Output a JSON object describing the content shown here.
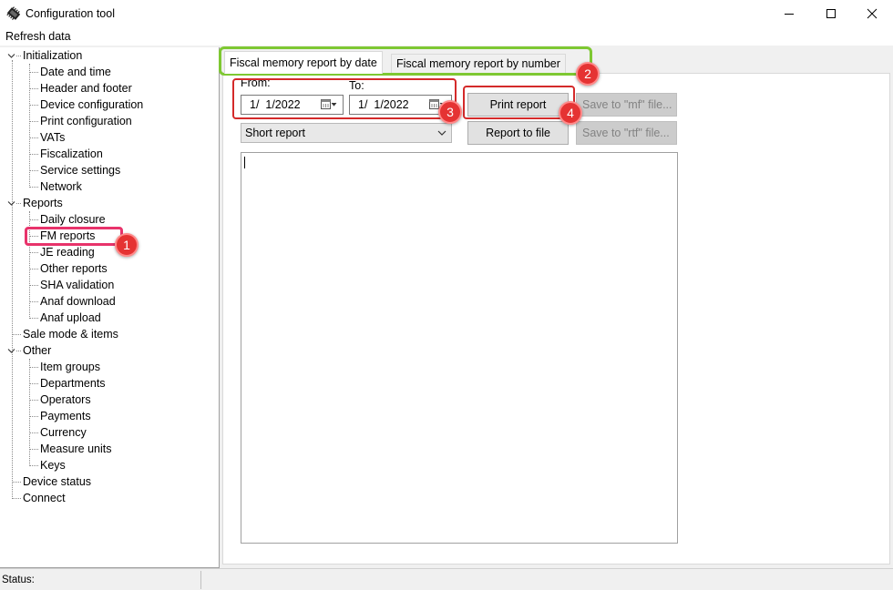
{
  "window": {
    "title": "Configuration tool",
    "controls": [
      "minimize",
      "maximize",
      "close"
    ]
  },
  "menu": {
    "refresh": "Refresh data"
  },
  "tree": {
    "initialization": {
      "label": "Initialization",
      "children": [
        "Date and time",
        "Header and footer",
        "Device configuration",
        "Print configuration",
        "VATs",
        "Fiscalization",
        "Service settings",
        "Network"
      ]
    },
    "reports": {
      "label": "Reports",
      "children": [
        "Daily closure",
        "FM reports",
        "JE reading",
        "Other reports",
        "SHA validation",
        "Anaf download",
        "Anaf upload"
      ]
    },
    "sale_mode": {
      "label": "Sale mode & items"
    },
    "other": {
      "label": "Other",
      "children": [
        "Item groups",
        "Departments",
        "Operators",
        "Payments",
        "Currency",
        "Measure units",
        "Keys"
      ]
    },
    "device_status": {
      "label": "Device status"
    },
    "connect": {
      "label": "Connect"
    }
  },
  "tabs": [
    {
      "label": "Fiscal memory report by date",
      "active": true
    },
    {
      "label": "Fiscal memory report by number",
      "active": false
    }
  ],
  "form": {
    "from_label": "From:",
    "to_label": "To:",
    "from_value": "1/  1/2022",
    "to_value": "1/  1/2022",
    "report_type": "Short report"
  },
  "buttons": {
    "print_report": "Print report",
    "report_to_file": "Report to file",
    "save_mf": "Save to \"mf\" file...",
    "save_rtf": "Save to \"rtf\" file..."
  },
  "annotations": [
    "1",
    "2",
    "3",
    "4"
  ],
  "colors": {
    "annotation_red": "#e53333",
    "highlight_pink": "#e8336b",
    "highlight_green": "#7ec832",
    "highlight_red": "#d42a2a"
  },
  "status": {
    "label": "Status:"
  }
}
